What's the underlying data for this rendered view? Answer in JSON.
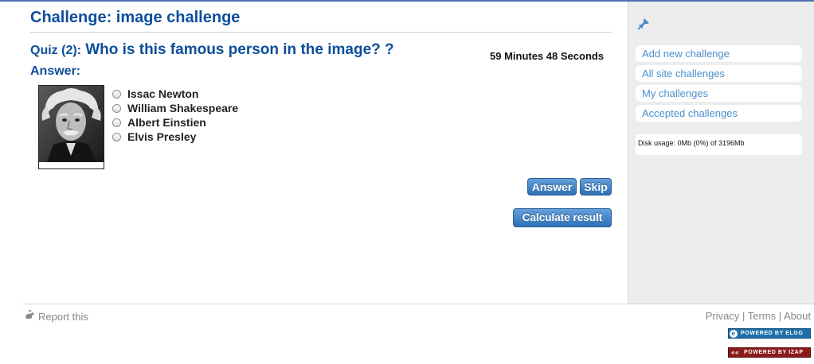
{
  "page": {
    "title": "Challenge: image challenge"
  },
  "quiz": {
    "number_label": "Quiz (2):",
    "question": "Who is this famous person in the image? ?",
    "timer": "59 Minutes 48 Seconds",
    "answer_label": "Answer:",
    "options": [
      "Issac Newton",
      "William Shakespeare",
      "Albert Einstien",
      "Elvis Presley"
    ],
    "selected_option": null
  },
  "buttons": {
    "answer": "Answer",
    "skip": "Skip",
    "calculate": "Calculate result"
  },
  "sidebar": {
    "items": [
      {
        "label": "Add new challenge"
      },
      {
        "label": "All site challenges"
      },
      {
        "label": "My challenges"
      },
      {
        "label": "Accepted challenges"
      }
    ],
    "disk_usage": "Disk usage: 0Mb (0%) of 3196Mb"
  },
  "footer": {
    "report": "Report this",
    "links": [
      "Privacy",
      "Terms",
      "About"
    ],
    "separator": " | ",
    "badges": {
      "elgg": "POWERED BY ELGG",
      "izap": "POWERED BY IZAP"
    }
  },
  "colors": {
    "title": "#0d4e9b",
    "link": "#4a8fcb",
    "button": "#2e6fb4",
    "sidebar_bg": "#ededed"
  },
  "icons": {
    "sidebar_pin": "pushpin-icon",
    "report": "report-icon"
  }
}
